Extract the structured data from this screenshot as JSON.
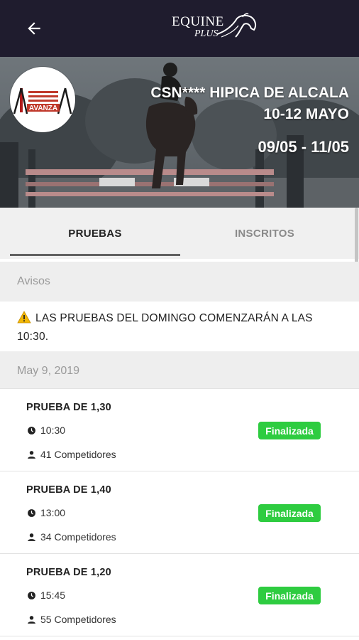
{
  "app": {
    "logo_line1": "EQUINE",
    "logo_line2": "PLUS"
  },
  "event": {
    "title": "CSN**** HIPICA DE ALCALA 10-12 MAYO",
    "dates": "09/05 - 11/05",
    "organizer_logo_text": "AVANZA"
  },
  "tabs": [
    {
      "label": "PRUEBAS",
      "selected": true
    },
    {
      "label": "INSCRITOS",
      "selected": false
    }
  ],
  "notices": {
    "header": "Avisos",
    "items": [
      {
        "icon": "warning-icon",
        "text": "LAS PRUEBAS DEL DOMINGO COMENZARÁN A LAS 10:30."
      }
    ]
  },
  "days": [
    {
      "date": "May 9, 2019",
      "events": [
        {
          "name": "PRUEBA DE 1,30",
          "time": "10:30",
          "competitors": "41 Competidores",
          "status": "Finalizada"
        },
        {
          "name": "PRUEBA DE 1,40",
          "time": "13:00",
          "competitors": "34 Competidores",
          "status": "Finalizada"
        },
        {
          "name": "PRUEBA DE 1,20",
          "time": "15:45",
          "competitors": "55 Competidores",
          "status": "Finalizada"
        }
      ]
    }
  ],
  "colors": {
    "appbar": "#1f1c2e",
    "status_finished": "#2ecc40",
    "tab_indicator": "#616161",
    "section_bg": "#eeeeee"
  }
}
